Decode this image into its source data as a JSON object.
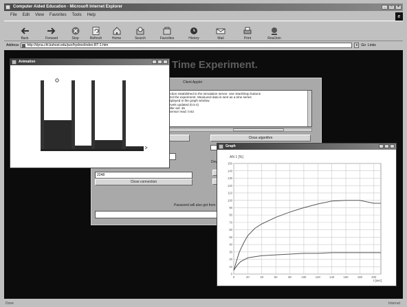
{
  "window": {
    "title": "Computer Aided Education - Microsoft Internet Explorer",
    "controls": [
      "_",
      "□",
      "×"
    ]
  },
  "menu": [
    "File",
    "Edit",
    "View",
    "Favorites",
    "Tools",
    "Help"
  ],
  "toolbar": [
    {
      "label": "Back",
      "icon": "back-arrow-icon"
    },
    {
      "label": "Forward",
      "icon": "forward-arrow-icon"
    },
    {
      "label": "Stop",
      "icon": "stop-icon"
    },
    {
      "label": "Refresh",
      "icon": "refresh-icon"
    },
    {
      "label": "Home",
      "icon": "home-icon"
    },
    {
      "label": "Search",
      "icon": "search-icon"
    },
    {
      "label": "Favorites",
      "icon": "favorites-icon"
    },
    {
      "label": "History",
      "icon": "history-icon"
    },
    {
      "label": "Mail",
      "icon": "mail-icon"
    },
    {
      "label": "Print",
      "icon": "print-icon"
    },
    {
      "label": "RealJoin",
      "icon": "realjoin-icon"
    }
  ],
  "address": {
    "label": "Address",
    "value": "http://dyna.chl.kuhost.edu/pzz/hydrex/index-RT-1.htm",
    "go_label": "Go",
    "links_label": "Links"
  },
  "page": {
    "heading": "Time Experiment.",
    "panel_title": "Client Applet",
    "panel_text": [
      "Connection established to the simulation server. Use Start/Stop buttons",
      "to control the experiment. Measured data is sent as a time series",
      "and displayed in the graph window.",
      "Tank levels updated (0.5 s)",
      "Controller set: 45",
      "Level sensor read: 0.62"
    ],
    "close_algorithm_label": "Close algorithm",
    "input_value": "2248",
    "close_connection_label": "Close connection",
    "side_label": "Dev.",
    "password_label": "Password will also get from"
  },
  "animation": {
    "title": "Animation",
    "tank1_level": 0.42,
    "tank2_level": 0.13,
    "tank3_level": 0.05
  },
  "graph": {
    "title": "Graph",
    "y_label": "AN 1 [%]",
    "x_unit": "t [sec]",
    "y_ticks": [
      "0",
      "10",
      "20",
      "30",
      "40",
      "50",
      "60",
      "70",
      "80",
      "90",
      "100",
      "110",
      "120",
      "130",
      "140",
      "150"
    ],
    "x_ticks": [
      "0",
      "20",
      "40",
      "60",
      "80",
      "100",
      "120",
      "140",
      "160",
      "180",
      "200"
    ]
  },
  "chart_data": {
    "type": "line",
    "xlabel": "t [sec]",
    "ylabel": "AN 1 [%]",
    "xlim": [
      0,
      210
    ],
    "ylim": [
      0,
      150
    ],
    "grid": true,
    "series": [
      {
        "x": [
          0,
          4,
          8,
          14,
          20,
          30,
          40,
          60,
          80,
          100,
          120,
          140,
          160,
          180,
          200,
          210
        ],
        "values": [
          5,
          18,
          30,
          42,
          52,
          62,
          68,
          77,
          84,
          90,
          95,
          99,
          100,
          100,
          96,
          96
        ]
      },
      {
        "x": [
          0,
          5,
          10,
          20,
          40,
          60,
          80,
          100,
          120,
          140,
          160,
          180,
          200,
          210
        ],
        "values": [
          5,
          12,
          17,
          22,
          25,
          26,
          27,
          28,
          28,
          29,
          29,
          29,
          29,
          29
        ]
      }
    ]
  },
  "status": {
    "left": "Done",
    "right": "Internet"
  }
}
